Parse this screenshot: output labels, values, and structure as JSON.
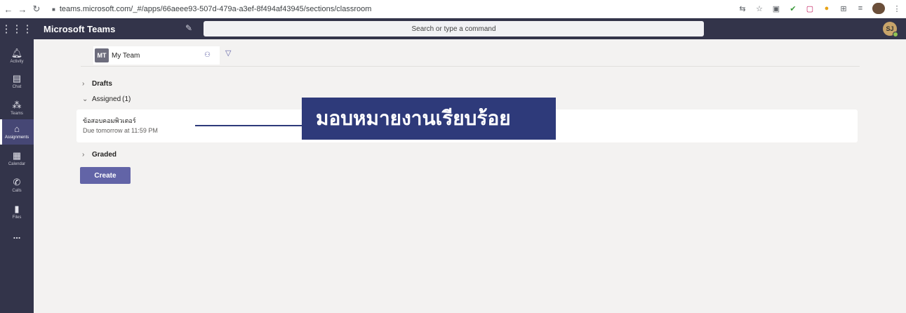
{
  "browser": {
    "back": "←",
    "forward": "→",
    "reload": "↻",
    "url": "teams.microsoft.com/_#/apps/66aeee93-507d-479a-a3ef-8f494af43945/sections/classroom"
  },
  "header": {
    "app_title": "Microsoft Teams",
    "search_placeholder": "Search or type a command",
    "avatar_initials": "SJ"
  },
  "rail": {
    "items": [
      {
        "label": "Activity"
      },
      {
        "label": "Chat"
      },
      {
        "label": "Teams"
      },
      {
        "label": "Assignments"
      },
      {
        "label": "Calendar"
      },
      {
        "label": "Calls"
      },
      {
        "label": "Files"
      }
    ],
    "more": "..."
  },
  "team": {
    "tile": "MT",
    "name": "My Team"
  },
  "sections": {
    "drafts": {
      "title": "Drafts"
    },
    "assigned": {
      "title": "Assigned",
      "count": "(1)"
    },
    "graded": {
      "title": "Graded"
    }
  },
  "assignment": {
    "title": "ข้อสอบคอมพิวเตอร์",
    "due": "Due tomorrow at 11:59 PM"
  },
  "callout": {
    "text": "มอบหมายงานเรียบร้อย"
  },
  "create_label": "Create",
  "colors": {
    "rail": "#33344a",
    "brand": "#6264a7",
    "callout": "#2e3a7a",
    "background": "#f3f2f1"
  }
}
